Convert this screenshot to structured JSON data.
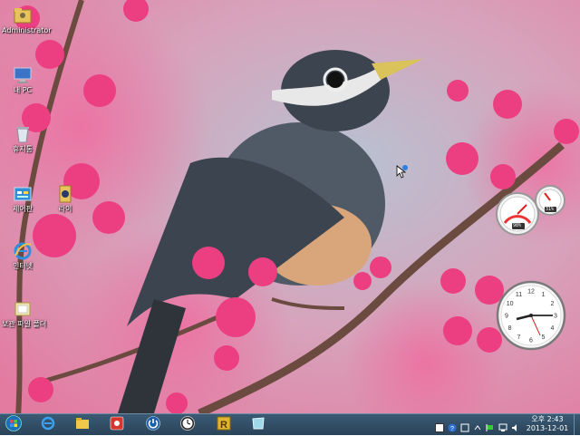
{
  "desktop": {
    "icons": [
      {
        "label": "Administrator",
        "icon": "user-folder-icon"
      },
      {
        "label": "내 PC",
        "icon": "computer-icon"
      },
      {
        "label": "휴지통",
        "icon": "recycle-bin-icon"
      },
      {
        "label": "제어판",
        "icon": "control-panel-icon"
      },
      {
        "label": "라이",
        "icon": "library-icon"
      },
      {
        "label": "인터넷",
        "icon": "internet-explorer-icon"
      },
      {
        "label": "보관 파일 폴더",
        "icon": "folder-icon"
      }
    ]
  },
  "gadgets": {
    "cpu_meter": {
      "cpu_label": "98%",
      "memory_label": "31%"
    },
    "clock": {
      "numerals": [
        "12",
        "1",
        "2",
        "3",
        "4",
        "5",
        "6",
        "7",
        "8",
        "9",
        "10",
        "11"
      ]
    }
  },
  "taskbar": {
    "pinned": [
      {
        "name": "start-button",
        "icon": "windows-logo-icon"
      },
      {
        "name": "internet-explorer",
        "icon": "internet-explorer-icon"
      },
      {
        "name": "file-explorer",
        "icon": "folder-icon"
      },
      {
        "name": "app-red",
        "icon": "red-app-icon"
      },
      {
        "name": "power-app",
        "icon": "power-icon"
      },
      {
        "name": "clock-app",
        "icon": "clock-app-icon"
      },
      {
        "name": "r-app",
        "icon": "r-app-icon"
      },
      {
        "name": "glass-app",
        "icon": "glass-app-icon"
      }
    ],
    "clock": {
      "time": "오후 2:43",
      "date": "2013-12-01"
    }
  },
  "colors": {
    "taskbar": "#2e4a60",
    "accent": "#1e88e5"
  }
}
